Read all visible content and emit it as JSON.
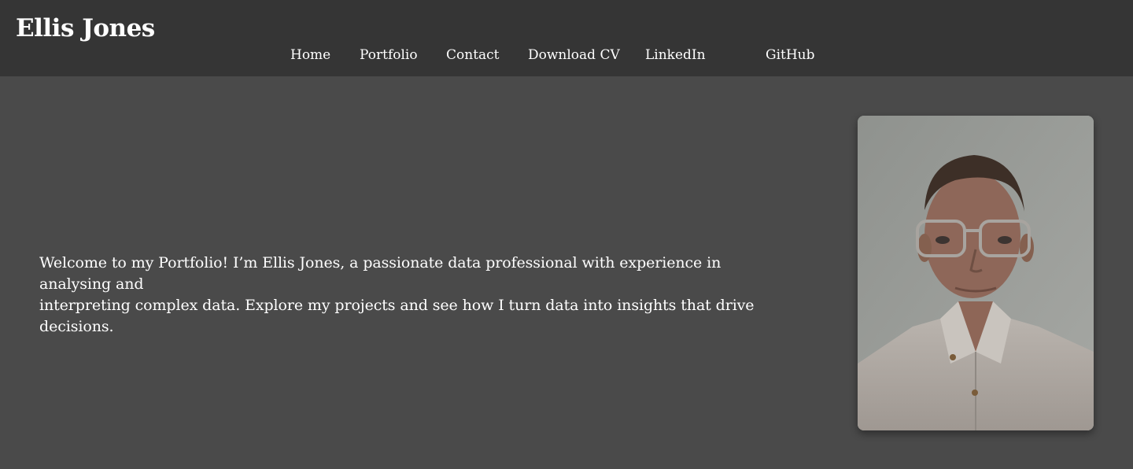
{
  "header": {
    "brand": "Ellis Jones",
    "nav": [
      {
        "label": "Home"
      },
      {
        "label": "Portfolio"
      },
      {
        "label": "Contact"
      },
      {
        "label": "Download CV"
      },
      {
        "label": "LinkedIn"
      },
      {
        "label": "GitHub"
      }
    ]
  },
  "hero": {
    "welcome_line1": "Welcome to my Portfolio! I’m Ellis Jones, a passionate data professional with experience in analysing and",
    "welcome_line2": "interpreting complex data. Explore my projects and see how I turn data into insights that drive decisions."
  },
  "colors": {
    "header_bg": "#353535",
    "page_bg": "#4a4a4a",
    "text": "#ffffff"
  }
}
